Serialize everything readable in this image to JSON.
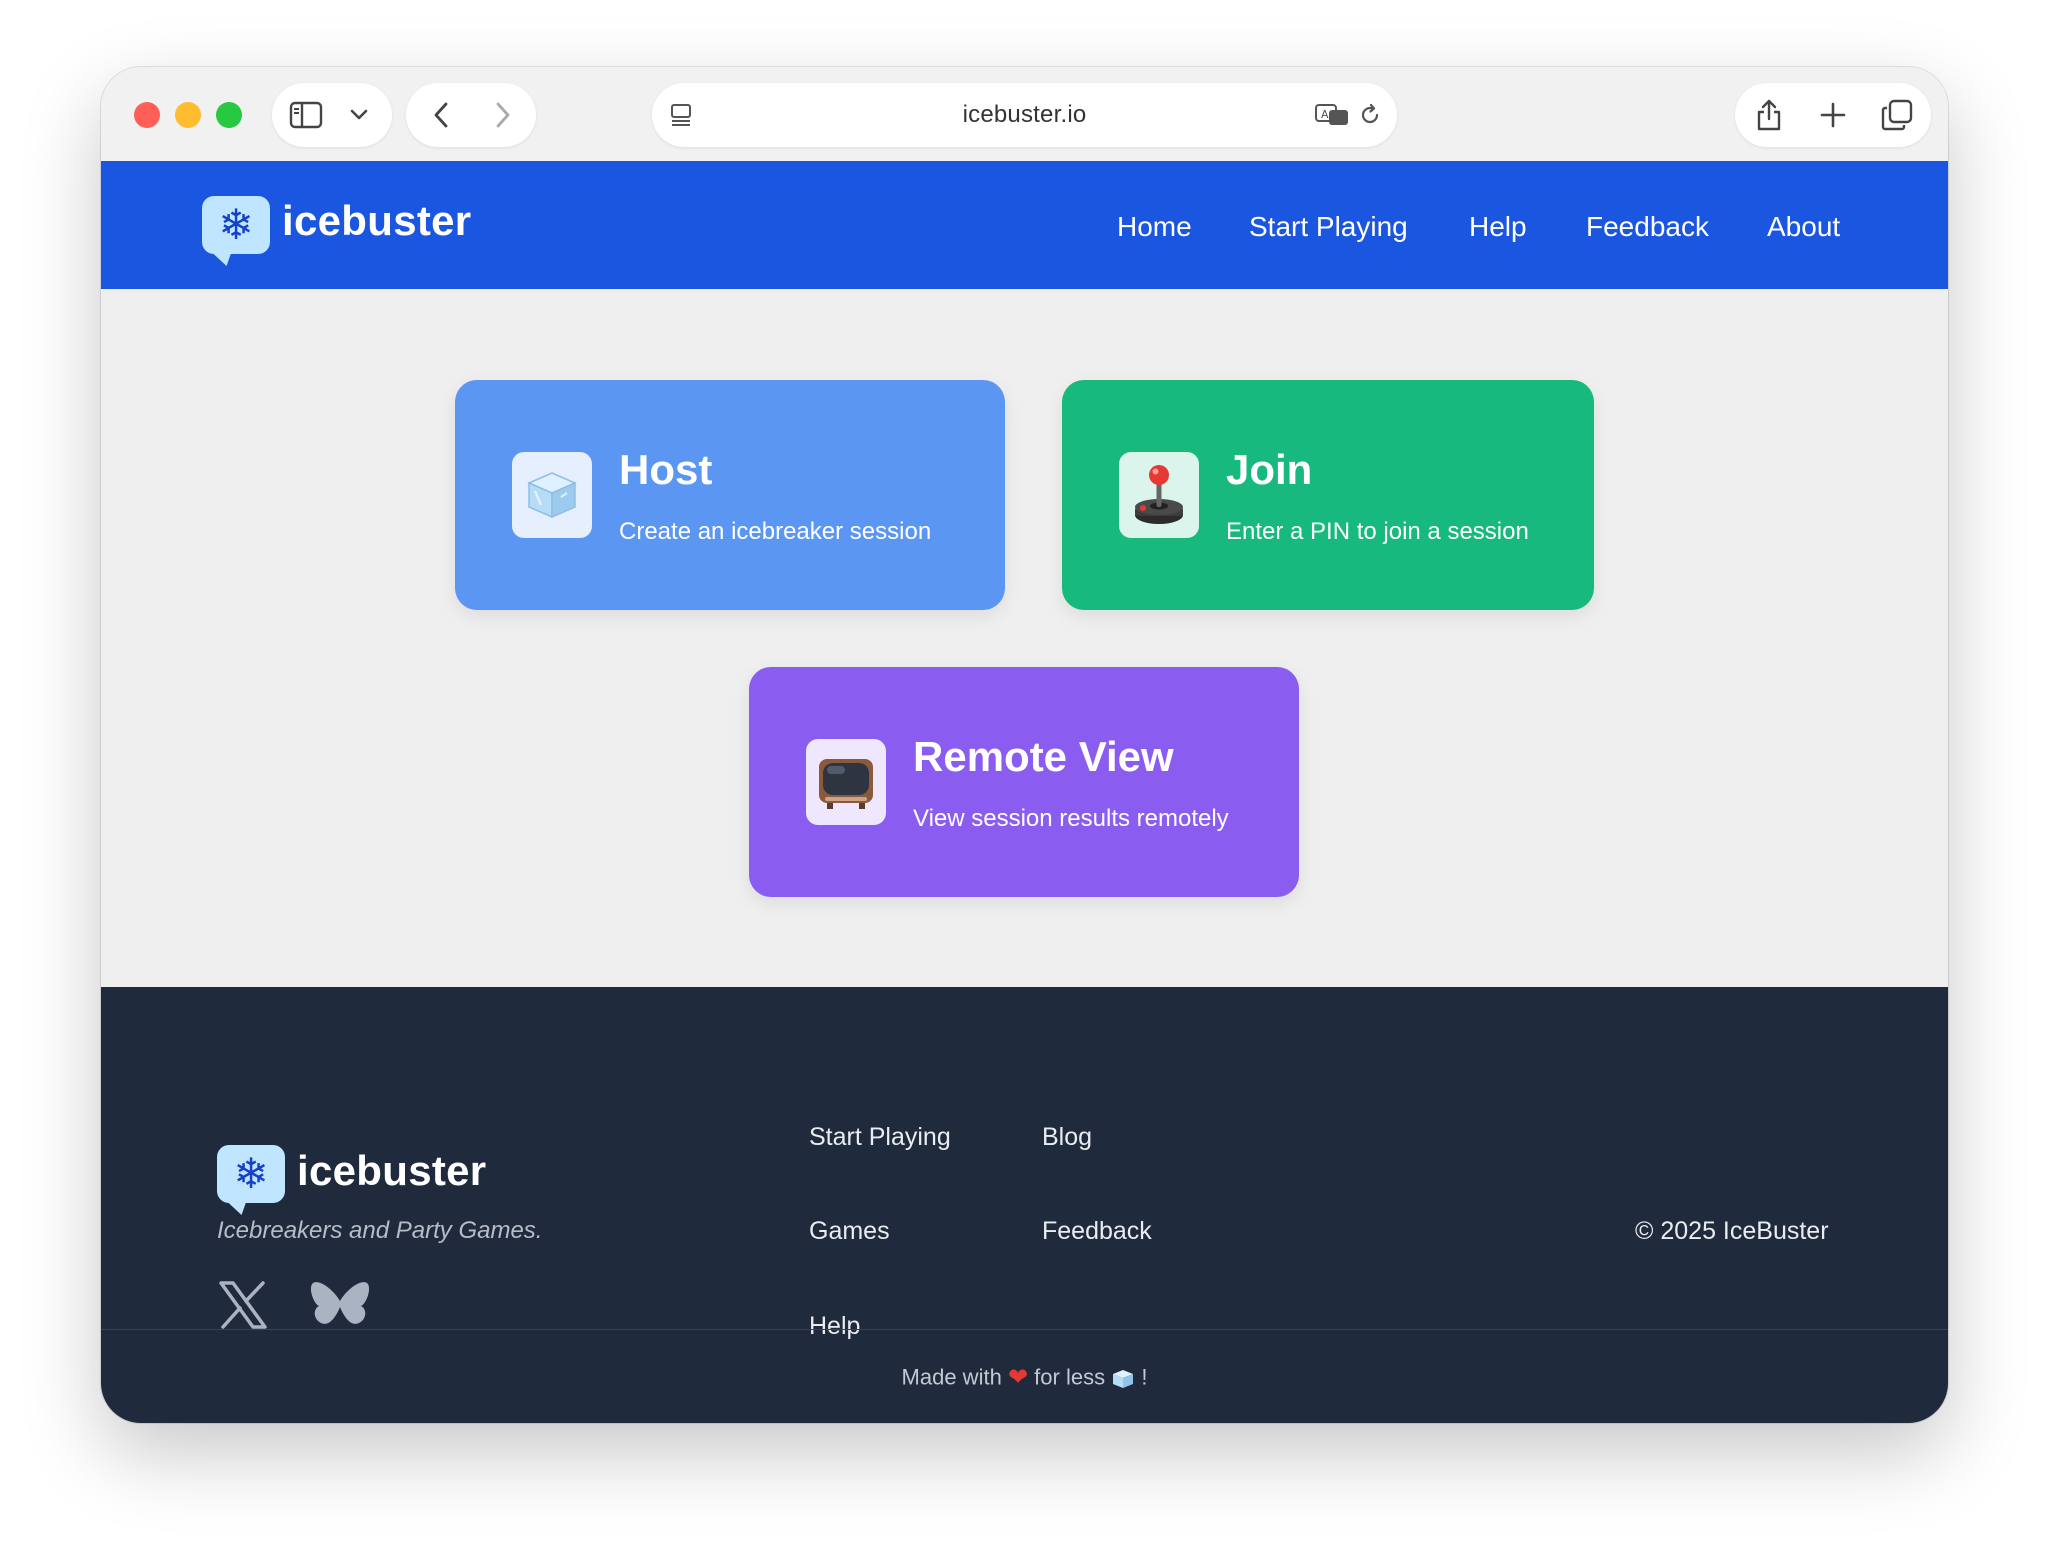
{
  "browser": {
    "url": "icebuster.io"
  },
  "header": {
    "logo_text": "icebuster",
    "nav": [
      {
        "label": "Home"
      },
      {
        "label": "Start Playing"
      },
      {
        "label": "Help"
      },
      {
        "label": "Feedback"
      },
      {
        "label": "About"
      }
    ]
  },
  "cards": {
    "host": {
      "title": "Host",
      "subtitle": "Create an icebreaker session",
      "icon": "ice-cube-icon",
      "color": "#5b96f2"
    },
    "join": {
      "title": "Join",
      "subtitle": "Enter a PIN to join a session",
      "icon": "joystick-icon",
      "color": "#17b97d"
    },
    "remote": {
      "title": "Remote View",
      "subtitle": "View session results remotely",
      "icon": "television-icon",
      "color": "#8b5cf0"
    }
  },
  "footer": {
    "logo_text": "icebuster",
    "tagline": "Icebreakers and Party Games.",
    "links_col1": [
      "Start Playing",
      "Games",
      "Help"
    ],
    "links_col2": [
      "Blog",
      "Feedback"
    ],
    "copyright": "© 2025 IceBuster",
    "made_with_prefix": "Made with",
    "made_with_middle": "for less",
    "made_with_suffix": "!"
  },
  "colors": {
    "header_bg": "#1a56e0",
    "footer_bg": "#1f2a3d",
    "page_bg": "#efefef"
  }
}
